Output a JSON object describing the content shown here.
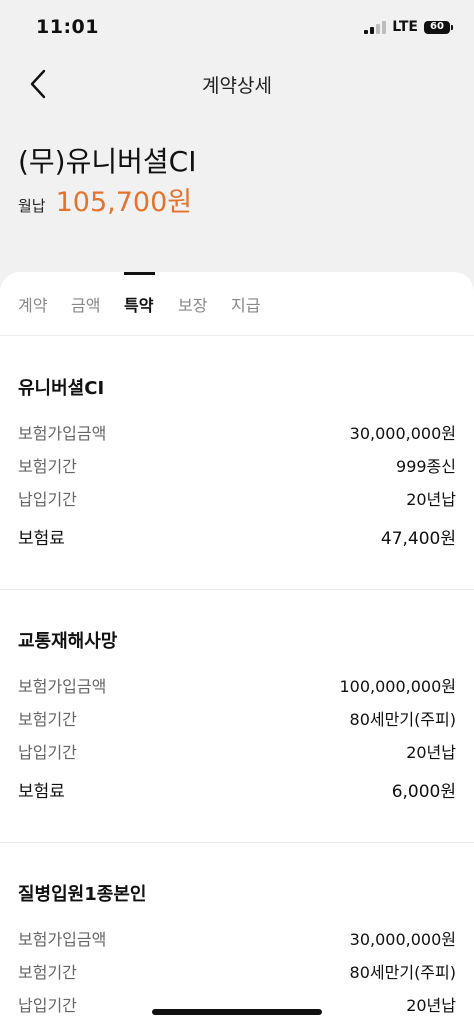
{
  "status": {
    "time": "11:01",
    "network": "LTE",
    "battery": "60"
  },
  "nav": {
    "title": "계약상세",
    "back_icon": "chevron-left-icon"
  },
  "product": {
    "name": "(무)유니버셜CI",
    "premium_label": "월납",
    "premium_value": "105,700원",
    "accent": "#e3742f"
  },
  "tabs": [
    {
      "label": "계약",
      "active": false
    },
    {
      "label": "금액",
      "active": false
    },
    {
      "label": "특약",
      "active": true
    },
    {
      "label": "보장",
      "active": false
    },
    {
      "label": "지급",
      "active": false
    }
  ],
  "riders": [
    {
      "title": "유니버셜CI",
      "rows": [
        {
          "label": "보험가입금액",
          "value": "30,000,000원"
        },
        {
          "label": "보험기간",
          "value": "999종신"
        },
        {
          "label": "납입기간",
          "value": "20년납"
        },
        {
          "label": "보험료",
          "value": "47,400원"
        }
      ]
    },
    {
      "title": "교통재해사망",
      "rows": [
        {
          "label": "보험가입금액",
          "value": "100,000,000원"
        },
        {
          "label": "보험기간",
          "value": "80세만기(주피)"
        },
        {
          "label": "납입기간",
          "value": "20년납"
        },
        {
          "label": "보험료",
          "value": "6,000원"
        }
      ]
    },
    {
      "title": "질병입원1종본인",
      "rows": [
        {
          "label": "보험가입금액",
          "value": "30,000,000원"
        },
        {
          "label": "보험기간",
          "value": "80세만기(주피)"
        },
        {
          "label": "납입기간",
          "value": "20년납"
        }
      ]
    }
  ]
}
